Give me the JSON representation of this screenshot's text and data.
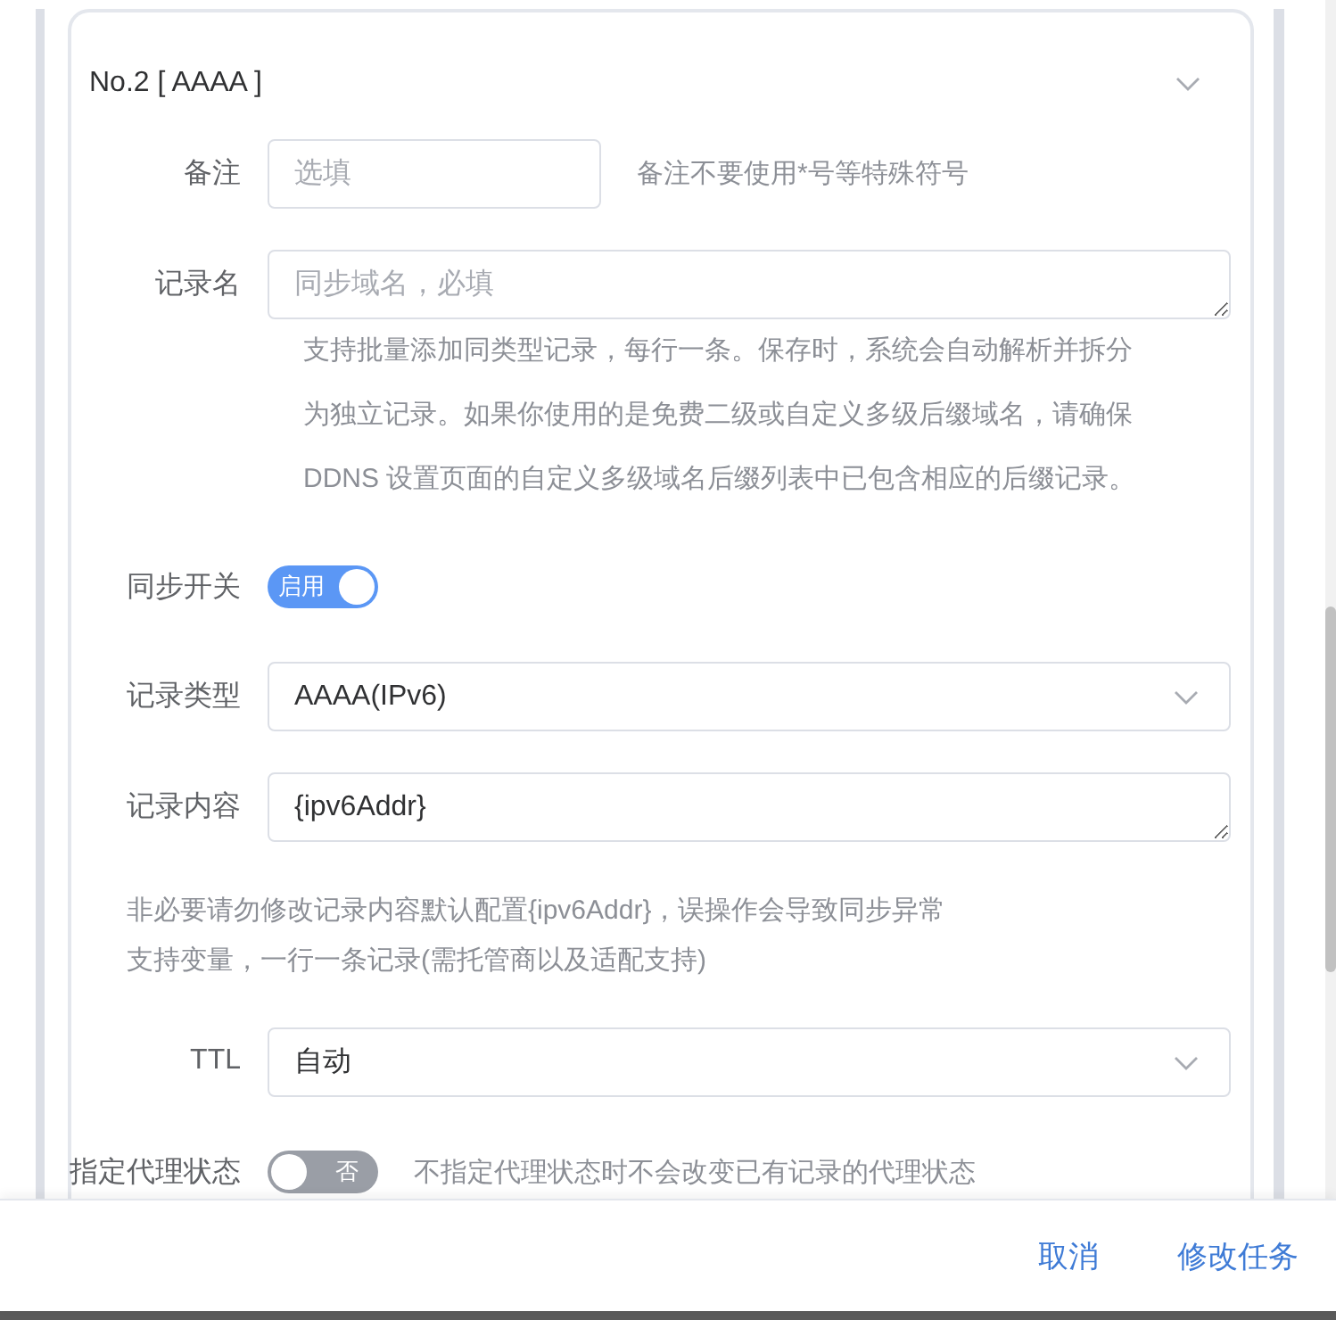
{
  "section": {
    "title": "No.2 [ AAAA ]",
    "expanded": true
  },
  "fields": [
    {
      "kind": "input",
      "label": "备注",
      "placeholder": "选填",
      "note": "备注不要使用*号等特殊符号"
    },
    {
      "kind": "textarea",
      "label": "记录名",
      "placeholder": "同步域名，必填",
      "help_lines": [
        "支持批量添加同类型记录，每行一条。保存时，系统会自动解析并拆分",
        "为独立记录。如果你使用的是免费二级或自定义多级后缀域名，请确保",
        "DDNS 设置页面的自定义多级域名后缀列表中已包含相应的后缀记录。"
      ]
    },
    {
      "kind": "switch",
      "label": "同步开关",
      "on": true,
      "switch_text": "启用"
    },
    {
      "kind": "select",
      "label": "记录类型",
      "value": "AAAA(IPv6)"
    },
    {
      "kind": "textarea",
      "label": "记录内容",
      "value": "{ipv6Addr}",
      "hints": [
        "非必要请勿修改记录内容默认配置{ipv6Addr}，误操作会导致同步异常",
        "支持变量，一行一条记录(需托管商以及适配支持)"
      ]
    },
    {
      "kind": "select",
      "label": "TTL",
      "value": "自动"
    },
    {
      "kind": "switch",
      "label": "指定代理状态",
      "on": false,
      "switch_text": "否",
      "note": "不指定代理状态时不会改变已有记录的代理状态"
    }
  ],
  "footer": {
    "buttons": [
      "取消",
      "修改任务"
    ]
  }
}
